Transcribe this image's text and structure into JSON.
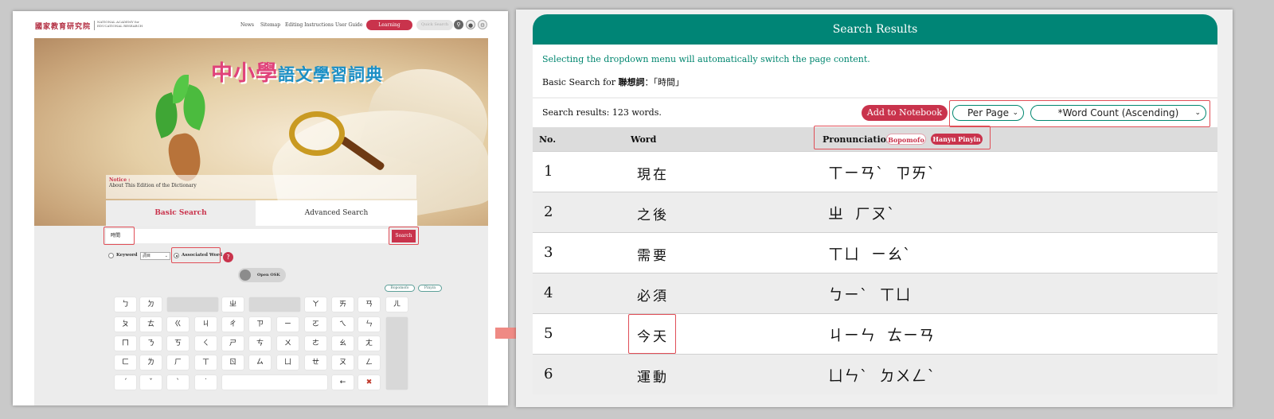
{
  "left": {
    "logo_cn": "國家教育研究院",
    "logo_en": "NATIONAL ACADEMY for EDUCATIONAL RESEARCH",
    "nav": [
      "News",
      "Sitemap",
      "Editing Instructions",
      "User Guide"
    ],
    "nav_notebook": "Learning Notebook",
    "quick_search_placeholder": "Quick Search",
    "banner_title_a": "中小學",
    "banner_title_b": "語文學習詞典",
    "notice_title": "Notice :",
    "notice_text": "About This Edition of the Dictionary",
    "tab_basic": "Basic Search",
    "tab_advanced": "Advanced Search",
    "search_value": "時間",
    "search_button": "Search",
    "keyword_label": "Keyword",
    "keyword_select": "詞目",
    "associated_label": "Associated Word",
    "help": "?",
    "osk_label": "Open OSK",
    "pill_bopomofo": "Bopomofo",
    "pill_pinyin": "Pinyin",
    "keys": [
      [
        "ㄅ",
        "ㄉ",
        "",
        "ㄓ",
        "",
        "ㄚ",
        "ㄞ",
        "ㄢ",
        "ㄦ"
      ],
      [
        "ㄆ",
        "ㄊ",
        "ㄍ",
        "ㄐ",
        "ㄔ",
        "ㄗ",
        "ㄧ",
        "ㄛ",
        "ㄟ",
        "ㄣ"
      ],
      [
        "ㄇ",
        "ㄋ",
        "ㄎ",
        "ㄑ",
        "ㄕ",
        "ㄘ",
        "ㄨ",
        "ㄜ",
        "ㄠ",
        "ㄤ"
      ],
      [
        "ㄈ",
        "ㄌ",
        "ㄏ",
        "ㄒ",
        "ㄖ",
        "ㄙ",
        "ㄩ",
        "ㄝ",
        "ㄡ",
        "ㄥ"
      ],
      [
        "ˊ",
        "ˇ",
        "ˋ",
        "˙",
        "",
        "←",
        "✖"
      ]
    ]
  },
  "right": {
    "header": "Search Results",
    "hint": "Selecting the dropdown menu will automatically switch the page content.",
    "basic_prefix": "Basic Search for ",
    "basic_term": "聯想詞",
    "basic_suffix": "：「時間」",
    "count": "Search results: 123 words.",
    "add_notebook": "Add to Notebook",
    "per_page": "Per Page",
    "sort": "*Word Count (Ascending)",
    "th_no": "No.",
    "th_word": "Word",
    "th_pron": "Pronunciation",
    "pill_bopomofo": "Bopomofo",
    "pill_pinyin": "Hanyu Pinyin",
    "rows": [
      {
        "no": "1",
        "word": "現在",
        "pron": "ㄒㄧㄢˋ  ㄗㄞˋ"
      },
      {
        "no": "2",
        "word": "之後",
        "pron": "ㄓ  ㄏㄡˋ"
      },
      {
        "no": "3",
        "word": "需要",
        "pron": "ㄒㄩ  ㄧㄠˋ"
      },
      {
        "no": "4",
        "word": "必須",
        "pron": "ㄅㄧˋ  ㄒㄩ"
      },
      {
        "no": "5",
        "word": "今天",
        "pron": "ㄐㄧㄣ  ㄊㄧㄢ"
      },
      {
        "no": "6",
        "word": "運動",
        "pron": "ㄩㄣˋ  ㄉㄨㄥˋ"
      }
    ]
  },
  "colors": {
    "teal": "#008576",
    "crimson": "#c9334c",
    "highlight": "#e04e57",
    "arrow": "#ef8a84"
  }
}
